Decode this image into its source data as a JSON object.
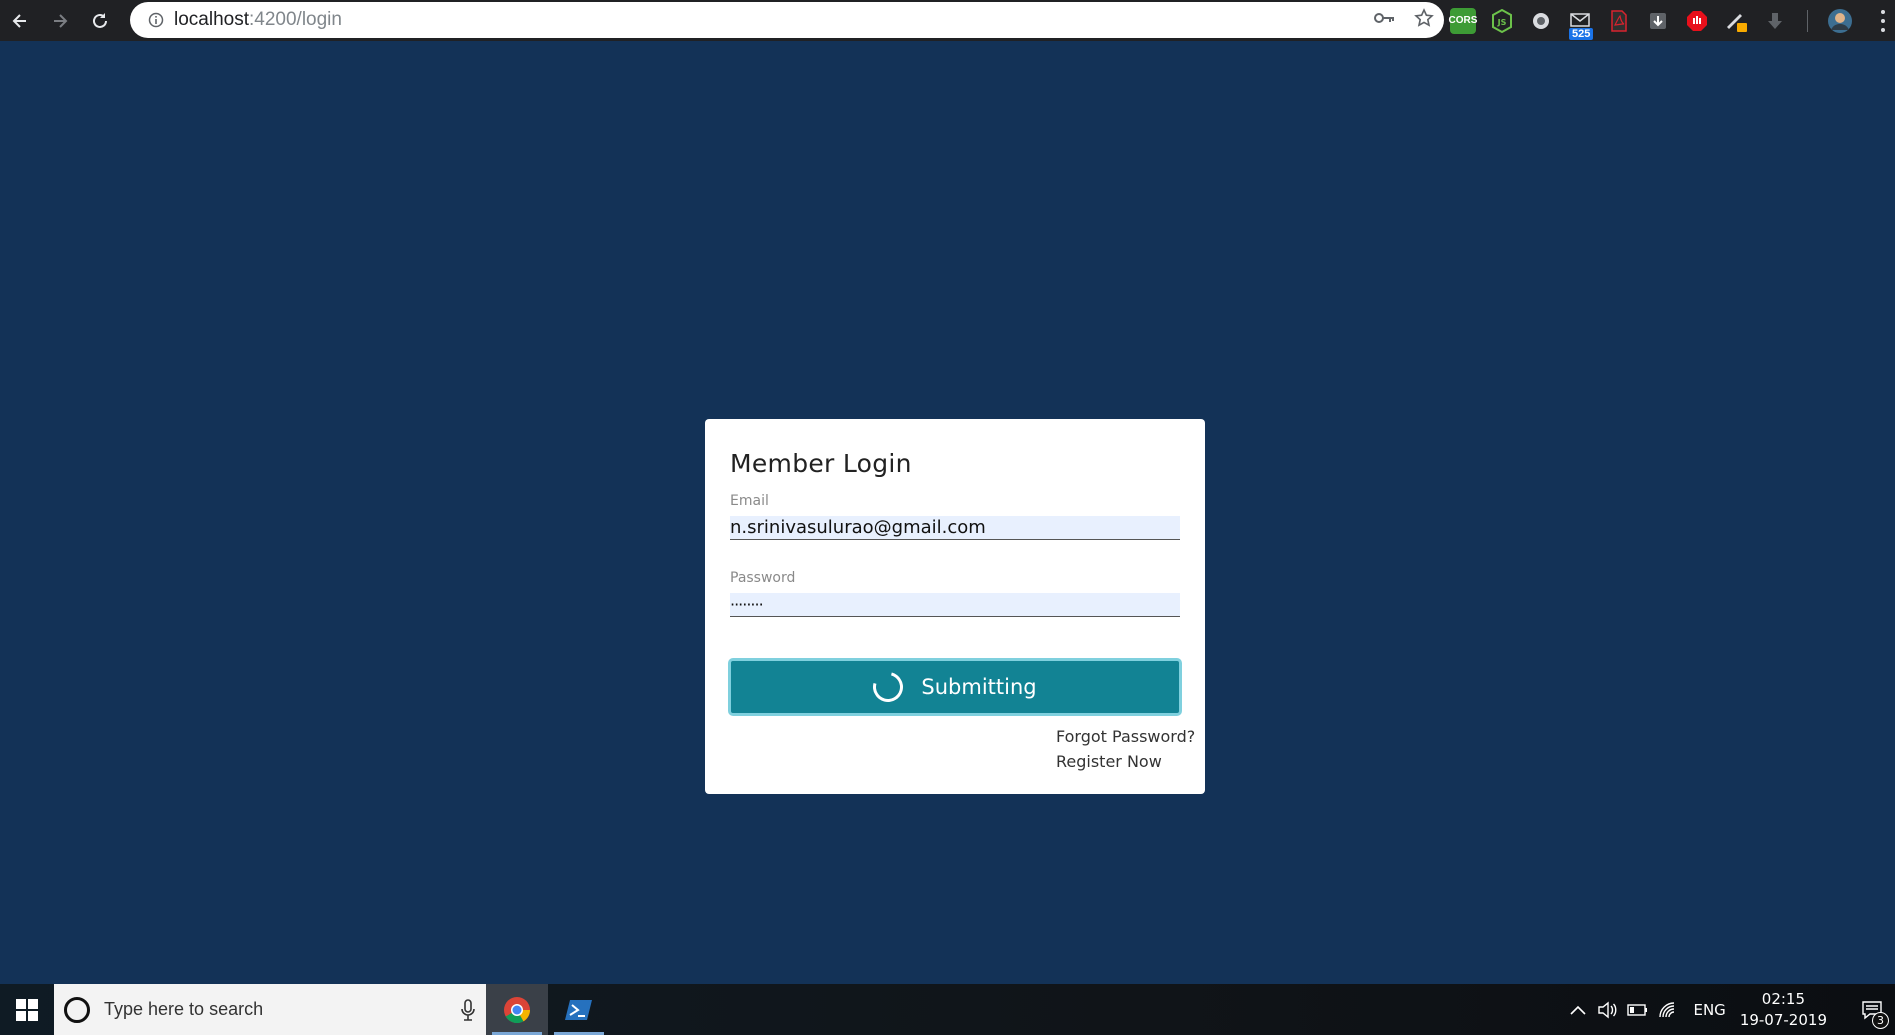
{
  "browser": {
    "url_host": "localhost",
    "url_path": ":4200/login",
    "extensions": [
      {
        "name": "cors-extension-icon",
        "label": "CORS",
        "color": "#3d9b35"
      },
      {
        "name": "nodejs-extension-icon",
        "label": "JS",
        "color": "#2f2f2f"
      },
      {
        "name": "circle-extension-icon",
        "label": "",
        "color": "#2f2f2f"
      },
      {
        "name": "mail-extension-icon",
        "label": "",
        "badge": "525",
        "color": "#2f2f2f"
      },
      {
        "name": "pdf-extension-icon",
        "label": "",
        "color": "#2f2f2f"
      },
      {
        "name": "download-extension-icon",
        "label": "",
        "color": "#2f2f2f"
      },
      {
        "name": "adblock-extension-icon",
        "label": "",
        "color": "#e8101b"
      },
      {
        "name": "pen-extension-icon",
        "label": "",
        "color": "#2f2f2f"
      },
      {
        "name": "download-arrow-extension-icon",
        "label": "",
        "color": "#2f2f2f"
      }
    ]
  },
  "login": {
    "title": "Member Login",
    "email_label": "Email",
    "email_value": "n.srinivasulurao@gmail.com",
    "password_label": "Password",
    "password_value": "········",
    "submit_label": "Submitting",
    "forgot_password": "Forgot Password?",
    "register": "Register Now"
  },
  "taskbar": {
    "search_placeholder": "Type here to search",
    "language": "ENG",
    "time": "02:15",
    "date": "19-07-2019",
    "notification_count": "3"
  },
  "colors": {
    "page_background": "#133257",
    "button": "#128394",
    "button_border": "#7fd0de",
    "input_autofill": "#e8f0fe"
  }
}
